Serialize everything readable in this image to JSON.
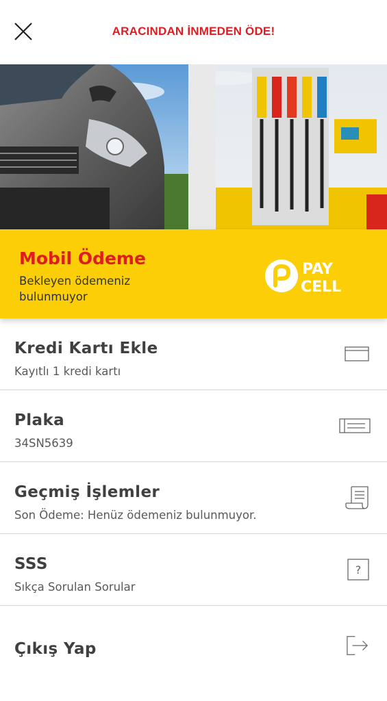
{
  "header": {
    "title": "ARACINDAN İNMEDEN ÖDE!"
  },
  "banner": {
    "title": "Mobil Ödeme",
    "subtitle": "Bekleyen ödemeniz bulunmuyor",
    "logo_text": [
      "PAY",
      "CELL"
    ]
  },
  "menu": [
    {
      "title": "Kredi Kartı Ekle",
      "subtitle": "Kayıtlı 1 kredi kartı",
      "icon": "credit-card-icon"
    },
    {
      "title": "Plaka",
      "subtitle": "34SN5639",
      "icon": "license-plate-icon"
    },
    {
      "title": "Geçmiş İşlemler",
      "subtitle": "Son Ödeme: Henüz ödemeniz bulunmuyor.",
      "icon": "receipt-icon"
    },
    {
      "title": "SSS",
      "subtitle": "Sıkça Sorulan Sorular",
      "icon": "question-icon"
    },
    {
      "title": "Çıkış Yap",
      "icon": "logout-icon"
    }
  ],
  "colors": {
    "accent": "#dd1d21",
    "brand_yellow": "#fbce07"
  }
}
